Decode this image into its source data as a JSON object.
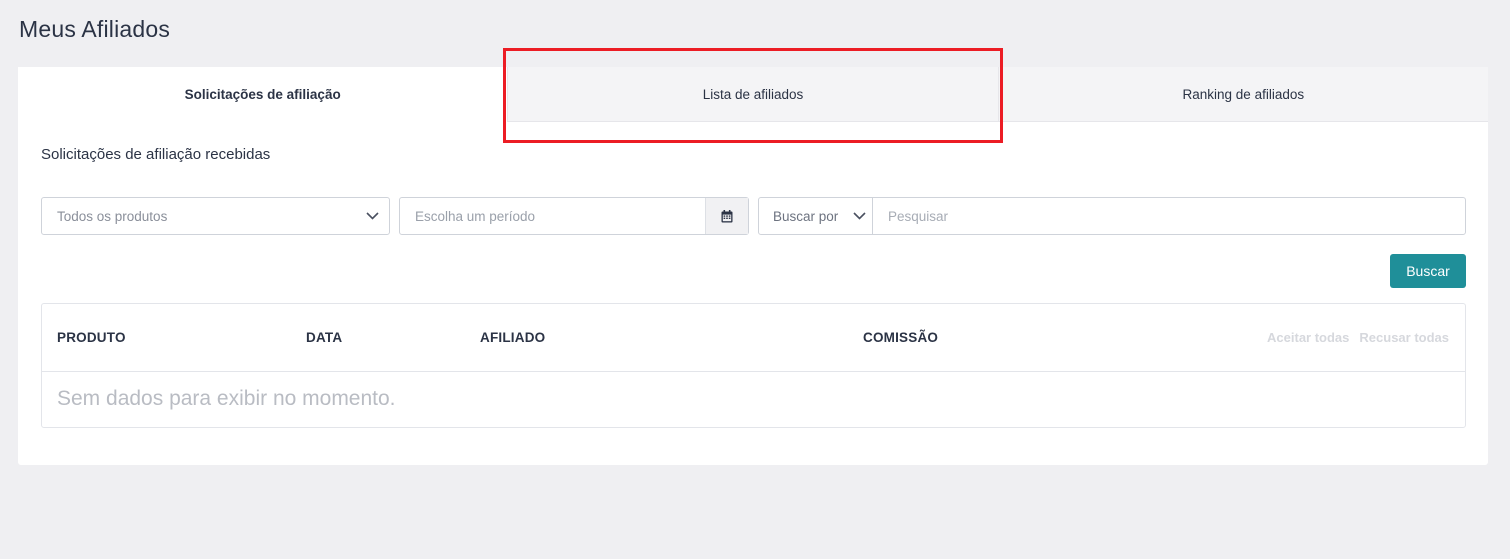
{
  "page": {
    "title": "Meus Afiliados"
  },
  "tabs": [
    {
      "label": "Solicitações de afiliação",
      "active": true
    },
    {
      "label": "Lista de afiliados",
      "active": false
    },
    {
      "label": "Ranking de afiliados",
      "active": false
    }
  ],
  "section": {
    "title": "Solicitações de afiliação recebidas"
  },
  "filters": {
    "product_select_value": "Todos os produtos",
    "period_placeholder": "Escolha um período",
    "search_by_value": "Buscar por",
    "search_placeholder": "Pesquisar"
  },
  "buttons": {
    "search_label": "Buscar"
  },
  "table": {
    "columns": [
      "PRODUTO",
      "DATA",
      "AFILIADO",
      "COMISSÃO"
    ],
    "accept_all": "Aceitar todas",
    "reject_all": "Recusar todas",
    "empty_message": "Sem dados para exibir no momento."
  },
  "colors": {
    "accent": "#1f8f99",
    "highlight": "#ec1c24",
    "background": "#efeff2"
  },
  "icons": {
    "select_chevron": "chevron-down-icon",
    "date": "calendar-icon"
  }
}
